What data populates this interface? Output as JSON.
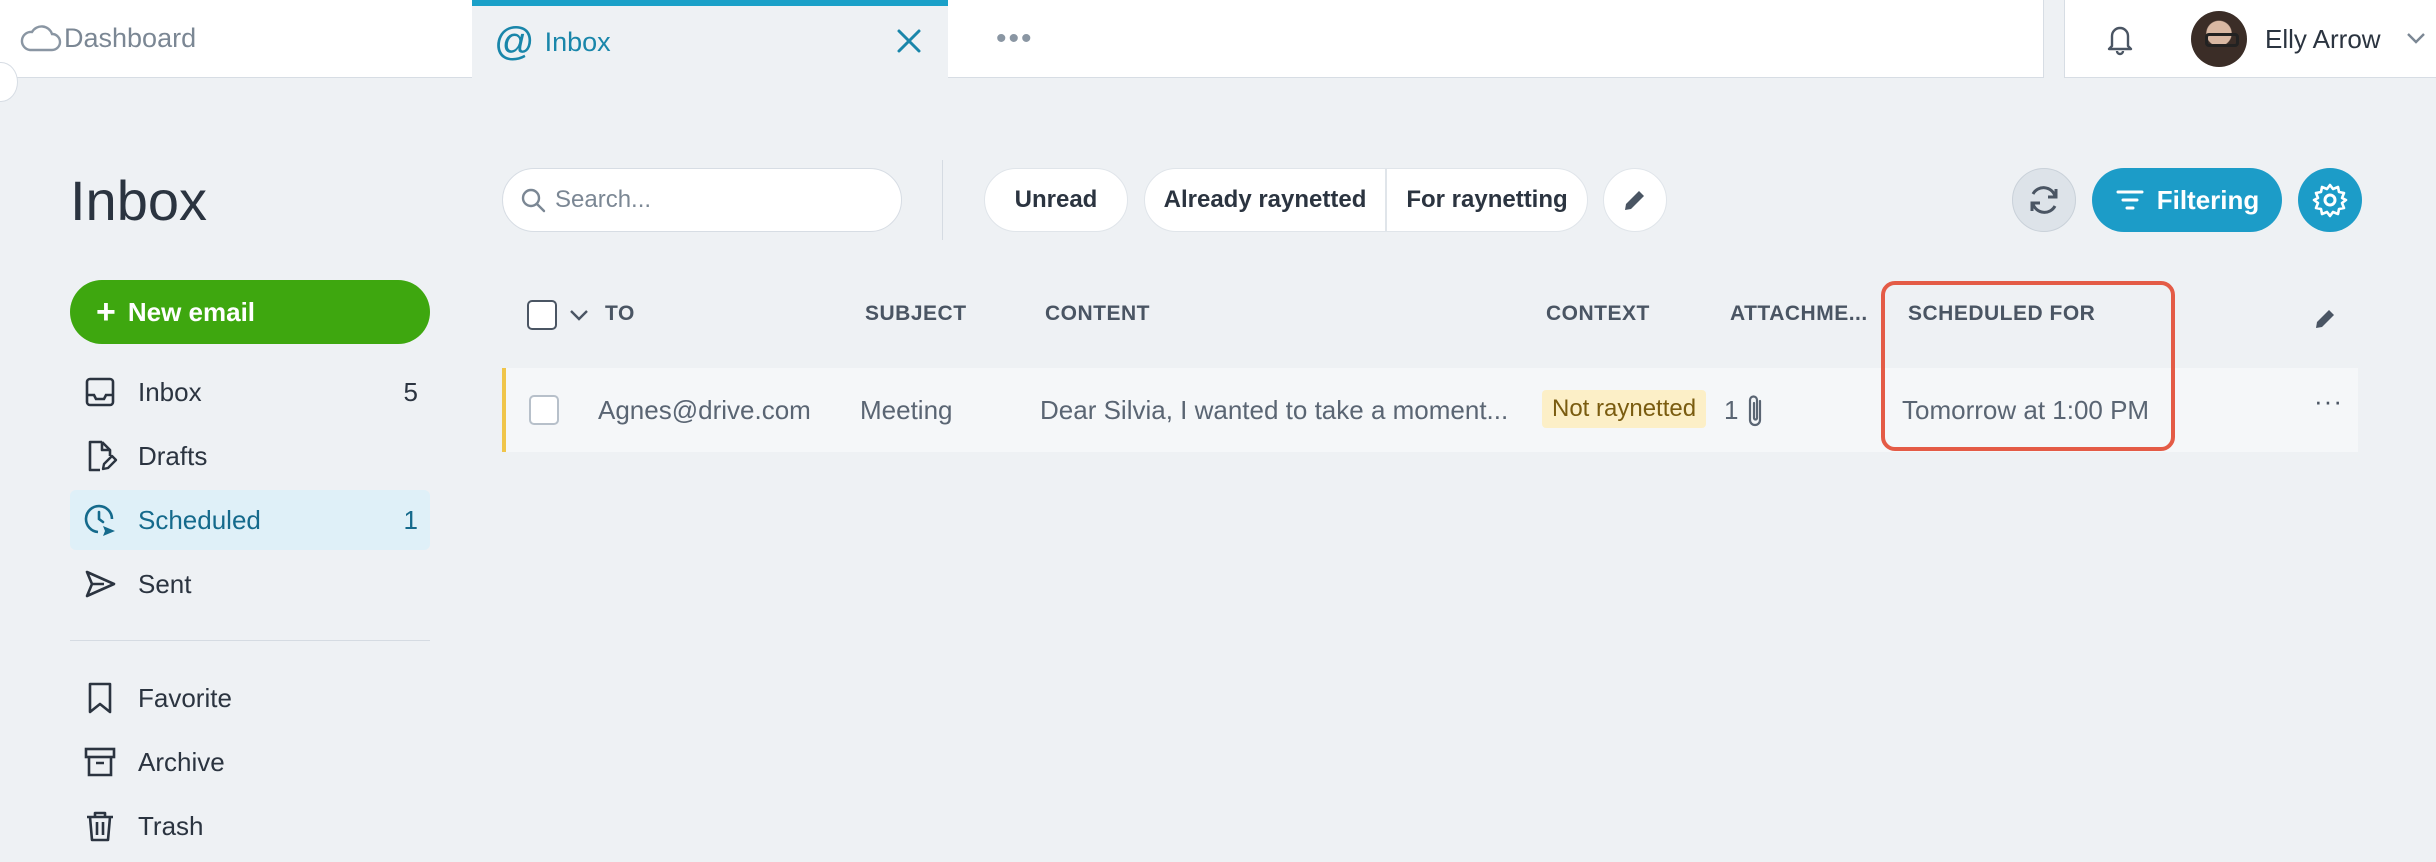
{
  "tabs": {
    "dashboard": "Dashboard",
    "inbox": "Inbox",
    "more": "•••"
  },
  "user": {
    "name": "Elly Arrow"
  },
  "page": {
    "title": "Inbox"
  },
  "sidebar": {
    "new_email": "New email",
    "items": [
      {
        "label": "Inbox",
        "count": "5",
        "icon": "inbox-icon"
      },
      {
        "label": "Drafts",
        "count": "",
        "icon": "drafts-icon"
      },
      {
        "label": "Scheduled",
        "count": "1",
        "icon": "scheduled-icon",
        "active": true
      },
      {
        "label": "Sent",
        "count": "",
        "icon": "sent-icon"
      },
      {
        "label": "Favorite",
        "count": "",
        "icon": "bookmark-icon"
      },
      {
        "label": "Archive",
        "count": "",
        "icon": "archive-icon"
      },
      {
        "label": "Trash",
        "count": "",
        "icon": "trash-icon"
      }
    ]
  },
  "toolbar": {
    "search_placeholder": "Search...",
    "unread": "Unread",
    "already": "Already raynetted",
    "for_raynetting": "For raynetting",
    "filtering": "Filtering"
  },
  "table": {
    "headers": {
      "to": "TO",
      "subject": "SUBJECT",
      "content": "CONTENT",
      "context": "CONTEXT",
      "attachments": "ATTACHME...",
      "scheduled": "SCHEDULED FOR"
    },
    "rows": [
      {
        "to": "Agnes@drive.com",
        "subject": "Meeting",
        "content": "Dear Silvia, I wanted to take a moment...",
        "context": "Not raynetted",
        "attachments": "1",
        "scheduled": "Tomorrow at 1:00 PM"
      }
    ]
  },
  "colors": {
    "accent": "#1c9cc8",
    "new_email": "#3ea70f",
    "highlight": "#e45b46",
    "row_marker": "#f0c54a"
  }
}
